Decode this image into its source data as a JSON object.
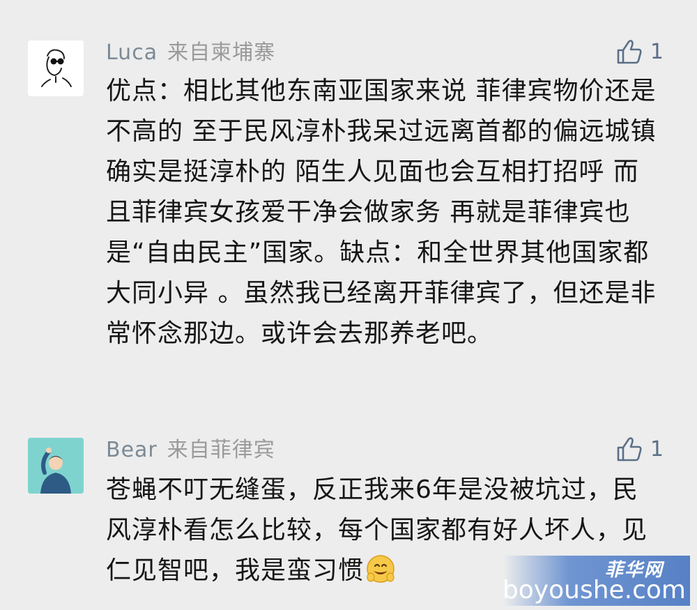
{
  "comments": [
    {
      "name": "Luca",
      "from": "来自柬埔寨",
      "likes": "1",
      "text": "优点：相比其他东南亚国家来说 菲律宾物价还是不高的 至于民风淳朴我呆过远离首都的偏远城镇 确实是挺淳朴的 陌生人见面也会互相打招呼 而且菲律宾女孩爱干净会做家务 再就是菲律宾也是“自由民主”国家。缺点：和全世界其他国家都大同小异 。虽然我已经离开菲律宾了，但还是非常怀念那边。或许会去那养老吧。",
      "avatar_icon": "sketch-person-sunglasses-avatar"
    },
    {
      "name": "Bear",
      "from": "来自菲律宾",
      "likes": "1",
      "text": "苍蝇不叮无缝蛋，反正我来6年是没被坑过，民风淳朴看怎么比较，每个国家都有好人坏人，见仁见智吧，我是蛮习惯",
      "avatar_icon": "illustrated-person-teal-avatar",
      "trailing_emoji": "smile-emoji"
    }
  ],
  "watermark": {
    "logo_text": "菲华网",
    "site_text": "boyoushe.com"
  },
  "colors": {
    "background": "#ededed",
    "name": "#7b8a96",
    "like_icon": "#5a6f86",
    "text": "#161616"
  }
}
